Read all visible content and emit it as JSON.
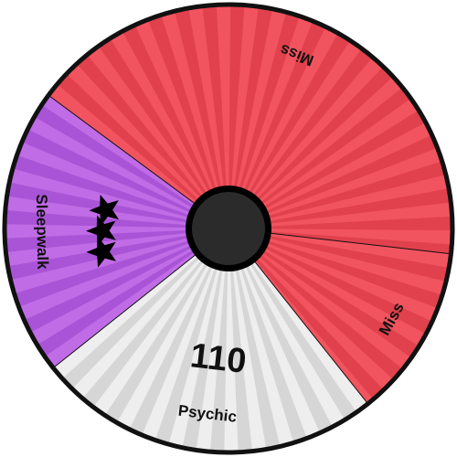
{
  "wheel": {
    "segments": [
      {
        "id": "miss-1",
        "label": "Miss",
        "color": "#f2545f",
        "stripe": "#e0414c",
        "size_units": 40
      },
      {
        "id": "miss-2",
        "label": "Miss",
        "color": "#f2545f",
        "stripe": "#e0414c",
        "size_units": 12
      },
      {
        "id": "psychic",
        "label": "Psychic",
        "power": "110",
        "color": "#eeeeee",
        "stripe": "#d6d6d6",
        "size_units": 24
      },
      {
        "id": "sleepwalk",
        "label": "Sleepwalk",
        "stars": 3,
        "color": "#c06ce6",
        "stripe": "#a954d6",
        "size_units": 20
      }
    ],
    "border_color": "#111111",
    "hub_color": "#2b2b2b",
    "star_icon": "star-icon"
  }
}
